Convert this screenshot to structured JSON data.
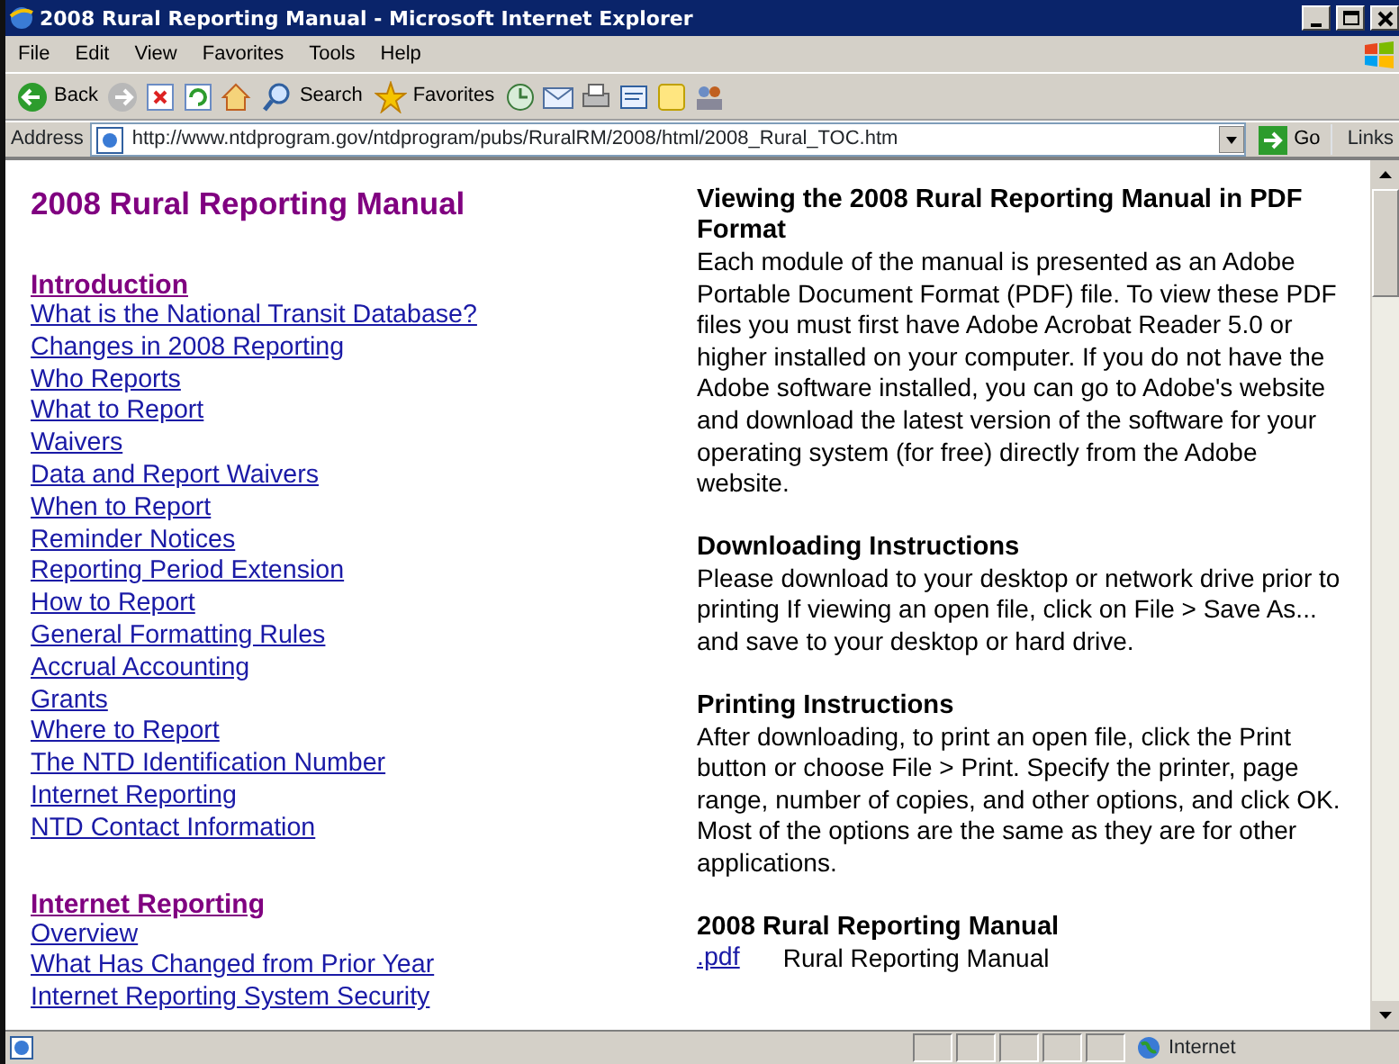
{
  "window": {
    "title": "2008 Rural Reporting Manual - Microsoft Internet Explorer"
  },
  "menu": [
    "File",
    "Edit",
    "View",
    "Favorites",
    "Tools",
    "Help"
  ],
  "toolbar": [
    {
      "kind": "back",
      "label": "Back"
    },
    {
      "kind": "forward"
    },
    {
      "kind": "stop"
    },
    {
      "kind": "refresh"
    },
    {
      "kind": "home"
    },
    {
      "kind": "search",
      "label": "Search"
    },
    {
      "kind": "favorites",
      "label": "Favorites"
    },
    {
      "kind": "history"
    },
    {
      "kind": "mail"
    },
    {
      "kind": "print"
    },
    {
      "kind": "edit"
    },
    {
      "kind": "note"
    },
    {
      "kind": "discuss"
    }
  ],
  "address": {
    "label": "Address",
    "url": "http://www.ntdprogram.gov/ntdprogram/pubs/RuralRM/2008/html/2008_Rural_TOC.htm",
    "go": "Go",
    "links": "Links"
  },
  "page": {
    "title": "2008 Rural Reporting Manual",
    "toc": [
      {
        "heading": "Introduction",
        "links": [
          "What is the National Transit Database?",
          "Changes in 2008 Reporting",
          "Who Reports",
          "What to Report",
          "Waivers",
          "Data and Report Waivers",
          "When to Report",
          "Reminder Notices",
          "Reporting Period Extension",
          "How to Report",
          "General Formatting Rules",
          "Accrual Accounting",
          "Grants",
          "Where to Report",
          "The NTD Identification Number",
          "Internet Reporting",
          "NTD Contact Information"
        ]
      },
      {
        "heading": "Internet Reporting",
        "links": [
          "Overview",
          "What Has Changed from Prior Year",
          "Internet Reporting System Security"
        ]
      }
    ],
    "sections": [
      {
        "heading": "Viewing the 2008 Rural Reporting Manual in PDF Format",
        "text": "Each module of the manual is presented as an Adobe Portable Document Format (PDF) file. To view these PDF files you must first have Adobe Acrobat Reader 5.0 or higher installed on your computer. If you do not have the Adobe software installed, you can go to Adobe's website and download the latest version of the software for your operating system (for free) directly from the Adobe website."
      },
      {
        "heading": "Downloading Instructions",
        "text": "Please download to your desktop or network drive prior to printing If viewing an open file, click on File > Save As... and save to your desktop or hard drive."
      },
      {
        "heading": "Printing Instructions",
        "text": "After downloading, to print an open file, click the Print button or choose File > Print. Specify the printer, page range, number of copies, and other options, and click OK. Most of the options are the same as they are for other applications."
      },
      {
        "heading": "2008 Rural Reporting Manual",
        "files": [
          {
            "link": ".pdf",
            "label": "Rural Reporting Manual"
          }
        ]
      }
    ]
  },
  "status_bar": {
    "zone": "Internet"
  }
}
